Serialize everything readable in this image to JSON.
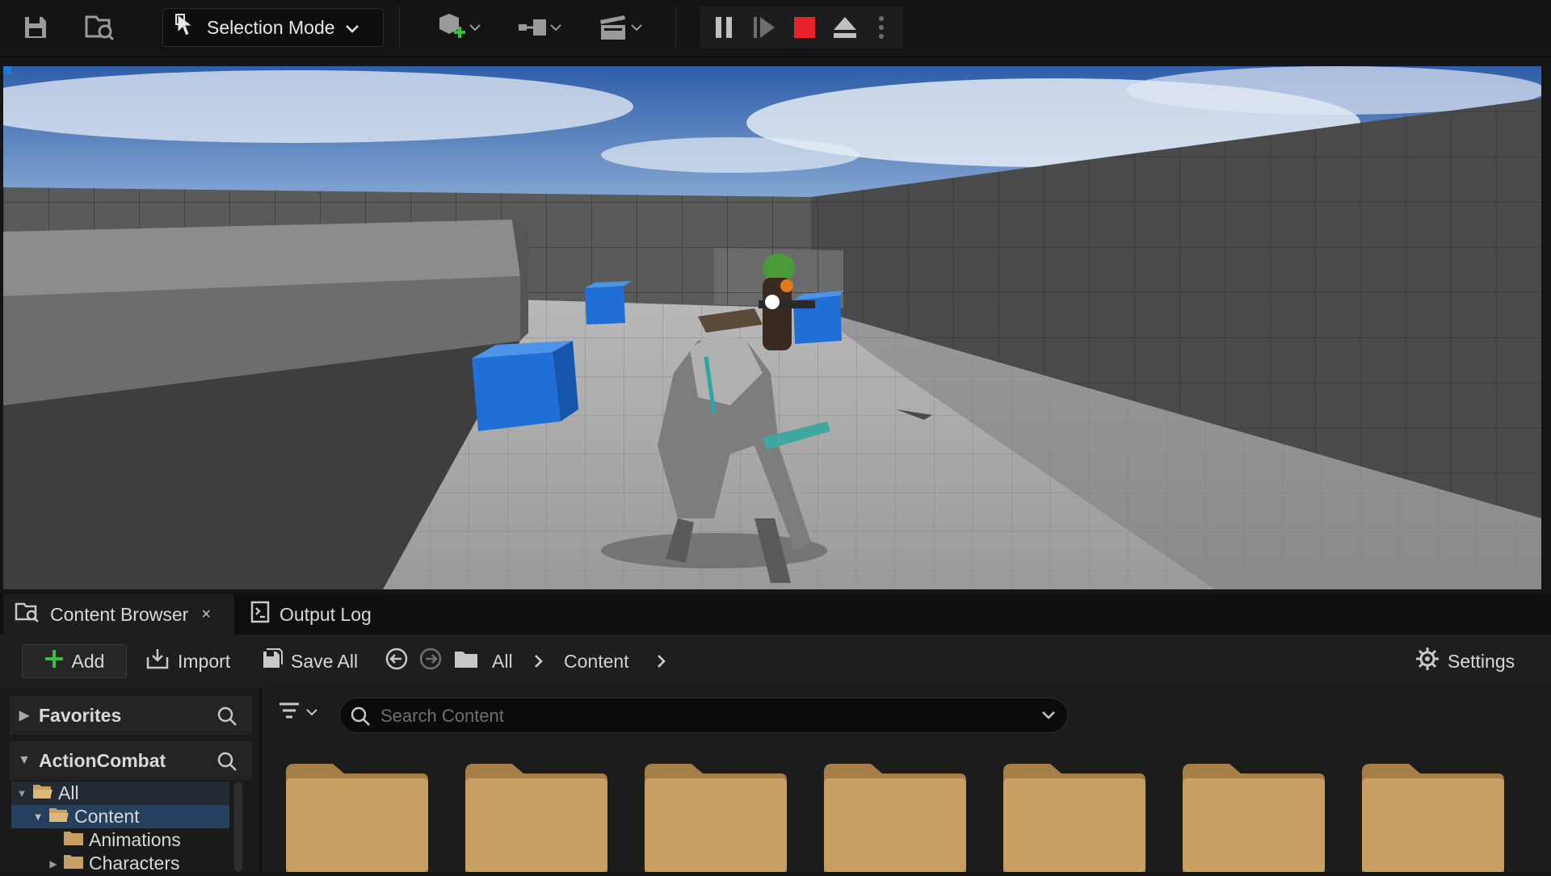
{
  "toolbar": {
    "mode_label": "Selection Mode",
    "icons": [
      "save-icon",
      "content-browser-icon",
      "select-arrow-icon",
      "add-actor-icon",
      "blueprint-icon",
      "cinematics-icon",
      "pause-icon",
      "skip-frame-icon",
      "stop-icon",
      "eject-icon",
      "more-options-icon"
    ]
  },
  "tabs": {
    "content_browser": "Content Browser",
    "content_browser_close": "×",
    "output_log": "Output Log"
  },
  "cb_toolbar": {
    "add_label": "Add",
    "import_label": "Import",
    "save_all_label": "Save All",
    "path": [
      "All",
      "Content"
    ],
    "settings_label": "Settings"
  },
  "sidebar": {
    "favorites_label": "Favorites",
    "project_label": "ActionCombat",
    "tree": [
      {
        "label": "All"
      },
      {
        "label": "Content"
      },
      {
        "label": "Animations"
      },
      {
        "label": "Characters"
      }
    ]
  },
  "search": {
    "placeholder": "Search Content"
  },
  "colors": {
    "stop_red": "#e8202a",
    "add_green": "#3cbf3c",
    "selection_blue": "#24405e",
    "folder_tan": "#c8a063",
    "cube_blue": "#1f6fd6"
  }
}
